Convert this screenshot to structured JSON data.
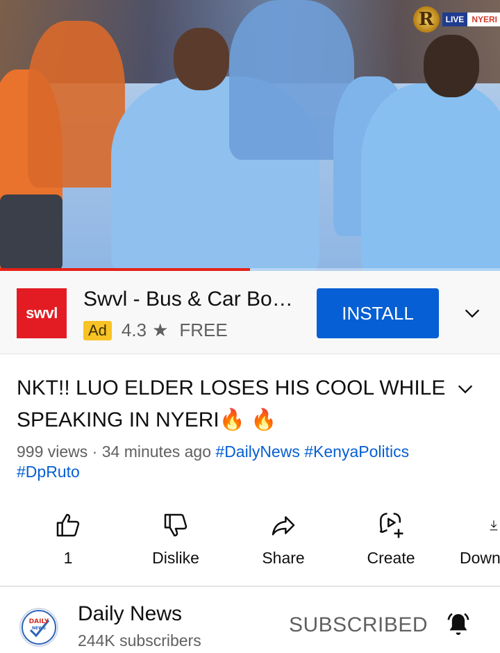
{
  "video": {
    "channel_logo_letter": "R",
    "live_label": "LIVE",
    "location_label": "NYERI",
    "progress_percent": 50
  },
  "ad": {
    "logo_text": "swvl",
    "title": "Swvl - Bus & Car Bo…",
    "badge": "Ad",
    "rating": "4.3",
    "price": "FREE",
    "install_label": "INSTALL",
    "accent_color": "#065fd4",
    "logo_color": "#e31c23"
  },
  "title": {
    "text": "NKT!! LUO ELDER LOSES HIS COOL WHILE SPEAKING IN NYERI🔥 🔥",
    "views": "999 views",
    "separator": " · ",
    "age": "34 minutes ago",
    "hashtags": [
      "#DailyNews",
      "#KenyaPolitics",
      "#DpRuto"
    ]
  },
  "actions": [
    {
      "key": "like",
      "label": "1",
      "icon": "thumbs-up-icon"
    },
    {
      "key": "dislike",
      "label": "Dislike",
      "icon": "thumbs-down-icon"
    },
    {
      "key": "share",
      "label": "Share",
      "icon": "share-icon"
    },
    {
      "key": "create",
      "label": "Create",
      "icon": "create-icon"
    },
    {
      "key": "download",
      "label": "Down",
      "icon": "download-icon"
    }
  ],
  "channel": {
    "name": "Daily News",
    "subscribers": "244K subscribers",
    "subscribe_state": "SUBSCRIBED",
    "avatar_text_top": "DAILY",
    "avatar_text_bottom": "NEWS"
  }
}
